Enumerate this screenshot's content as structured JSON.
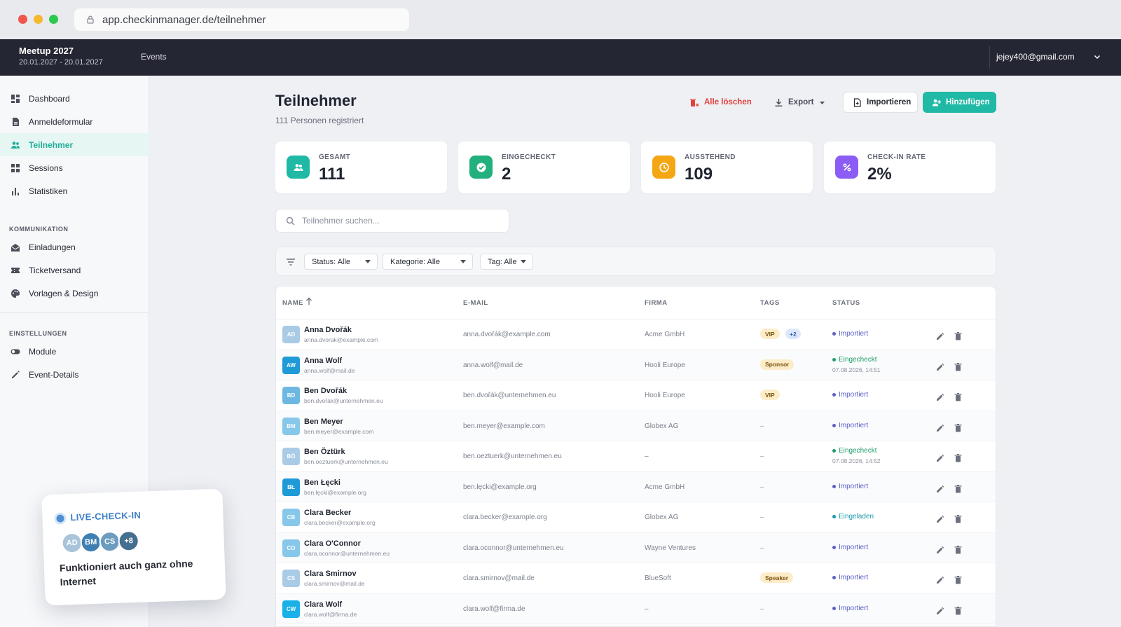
{
  "browser": {
    "url": "app.checkinmanager.de/teilnehmer"
  },
  "topbar": {
    "event_title": "Meetup 2027",
    "event_dates": "20.01.2027 - 20.01.2027",
    "nav_events": "Events",
    "user_email": "jejey400@gmail.com"
  },
  "sidebar": {
    "items": [
      {
        "label": "Dashboard",
        "icon": "dashboard-icon"
      },
      {
        "label": "Anmeldeformular",
        "icon": "form-icon"
      },
      {
        "label": "Teilnehmer",
        "icon": "people-icon",
        "active": true
      },
      {
        "label": "Sessions",
        "icon": "grid-icon"
      },
      {
        "label": "Statistiken",
        "icon": "bar-chart-icon"
      }
    ],
    "section_communication": "KOMMUNIKATION",
    "communication_items": [
      {
        "label": "Einladungen",
        "icon": "mail-open-icon"
      },
      {
        "label": "Ticketversand",
        "icon": "ticket-icon"
      },
      {
        "label": "Vorlagen & Design",
        "icon": "palette-icon"
      }
    ],
    "section_settings": "EINSTELLUNGEN",
    "settings_items": [
      {
        "label": "Module",
        "icon": "toggle-icon"
      },
      {
        "label": "Event-Details",
        "icon": "pencil-icon"
      }
    ]
  },
  "live_card": {
    "label": "LIVE-CHECK-IN",
    "avatars": [
      "AD",
      "BM",
      "CS",
      "+8"
    ],
    "text": "Funktioniert auch ganz ohne Internet"
  },
  "page": {
    "title": "Teilnehmer",
    "subtitle": "111 Personen registriert",
    "btn_delete_all": "Alle löschen",
    "btn_export": "Export",
    "btn_import": "Importieren",
    "btn_add": "Hinzufügen"
  },
  "stats": [
    {
      "label": "GESAMT",
      "value": "111",
      "color": "#1fb9a5"
    },
    {
      "label": "EINGECHECKT",
      "value": "2",
      "color": "#22b07d"
    },
    {
      "label": "AUSSTEHEND",
      "value": "109",
      "color": "#f5a614"
    },
    {
      "label": "CHECK-IN RATE",
      "value": "2%",
      "color": "#8b5cf6"
    }
  ],
  "search": {
    "placeholder": "Teilnehmer suchen..."
  },
  "filters": {
    "status": "Status: Alle",
    "category": "Kategorie: Alle",
    "tag": "Tag: Alle"
  },
  "table": {
    "columns": [
      "NAME",
      "E-MAIL",
      "FIRMA",
      "TAGS",
      "STATUS"
    ],
    "rows": [
      {
        "initials": "AD",
        "avatar_color": "#a9cbe6",
        "name": "Anna Dvořák",
        "sub_email": "anna.dvorak@example.com",
        "email": "anna.dvořák@example.com",
        "company": "Acme GmbH",
        "tags": [
          "VIP"
        ],
        "tag_more": "+2",
        "status": "Importiert",
        "status_time": ""
      },
      {
        "initials": "AW",
        "avatar_color": "#1e9ad6",
        "name": "Anna Wolf",
        "sub_email": "anna.wolf@mail.de",
        "email": "anna.wolf@mail.de",
        "company": "Hooli Europe",
        "tags": [
          "Sponsor"
        ],
        "tag_more": "",
        "status": "Eingecheckt",
        "status_time": "07.08.2026, 14:51"
      },
      {
        "initials": "BD",
        "avatar_color": "#6db8e3",
        "name": "Ben Dvořák",
        "sub_email": "ben.dvořák@unternehmen.eu",
        "email": "ben.dvořák@unternehmen.eu",
        "company": "Hooli Europe",
        "tags": [
          "VIP"
        ],
        "tag_more": "",
        "status": "Importiert",
        "status_time": ""
      },
      {
        "initials": "BM",
        "avatar_color": "#86c7ea",
        "name": "Ben Meyer",
        "sub_email": "ben.meyer@example.com",
        "email": "ben.meyer@example.com",
        "company": "Globex AG",
        "tags": [],
        "tag_more": "",
        "status": "Importiert",
        "status_time": ""
      },
      {
        "initials": "BÖ",
        "avatar_color": "#a9cbe6",
        "name": "Ben Öztürk",
        "sub_email": "ben.oeztuerk@unternehmen.eu",
        "email": "ben.oeztuerk@unternehmen.eu",
        "company": "–",
        "tags": [],
        "tag_more": "",
        "status": "Eingecheckt",
        "status_time": "07.08.2026, 14:52"
      },
      {
        "initials": "BŁ",
        "avatar_color": "#1e9ad6",
        "name": "Ben Łęcki",
        "sub_email": "ben.łęcki@example.org",
        "email": "ben.łęcki@example.org",
        "company": "Acme GmbH",
        "tags": [],
        "tag_more": "",
        "status": "Importiert",
        "status_time": ""
      },
      {
        "initials": "CB",
        "avatar_color": "#86c7ea",
        "name": "Clara Becker",
        "sub_email": "clara.becker@example.org",
        "email": "clara.becker@example.org",
        "company": "Globex AG",
        "tags": [],
        "tag_more": "",
        "status": "Eingeladen",
        "status_time": ""
      },
      {
        "initials": "CO",
        "avatar_color": "#86c7ea",
        "name": "Clara O'Connor",
        "sub_email": "clara.oconnor@unternehmen.eu",
        "email": "clara.oconnor@unternehmen.eu",
        "company": "Wayne Ventures",
        "tags": [],
        "tag_more": "",
        "status": "Importiert",
        "status_time": ""
      },
      {
        "initials": "CS",
        "avatar_color": "#a9cbe6",
        "name": "Clara Smirnov",
        "sub_email": "clara.smirnov@mail.de",
        "email": "clara.smirnov@mail.de",
        "company": "BlueSoft",
        "tags": [
          "Speaker"
        ],
        "tag_more": "",
        "status": "Importiert",
        "status_time": ""
      },
      {
        "initials": "CW",
        "avatar_color": "#1ab0e8",
        "name": "Clara Wolf",
        "sub_email": "clara.wolf@firma.de",
        "email": "clara.wolf@firma.de",
        "company": "–",
        "tags": [],
        "tag_more": "",
        "status": "Importiert",
        "status_time": ""
      }
    ],
    "empty_dash": "–"
  },
  "status_colors": {
    "Importiert": "#5a5fc8",
    "Eingecheckt": "#1f9d6b",
    "Eingeladen": "#1a9bb0"
  }
}
